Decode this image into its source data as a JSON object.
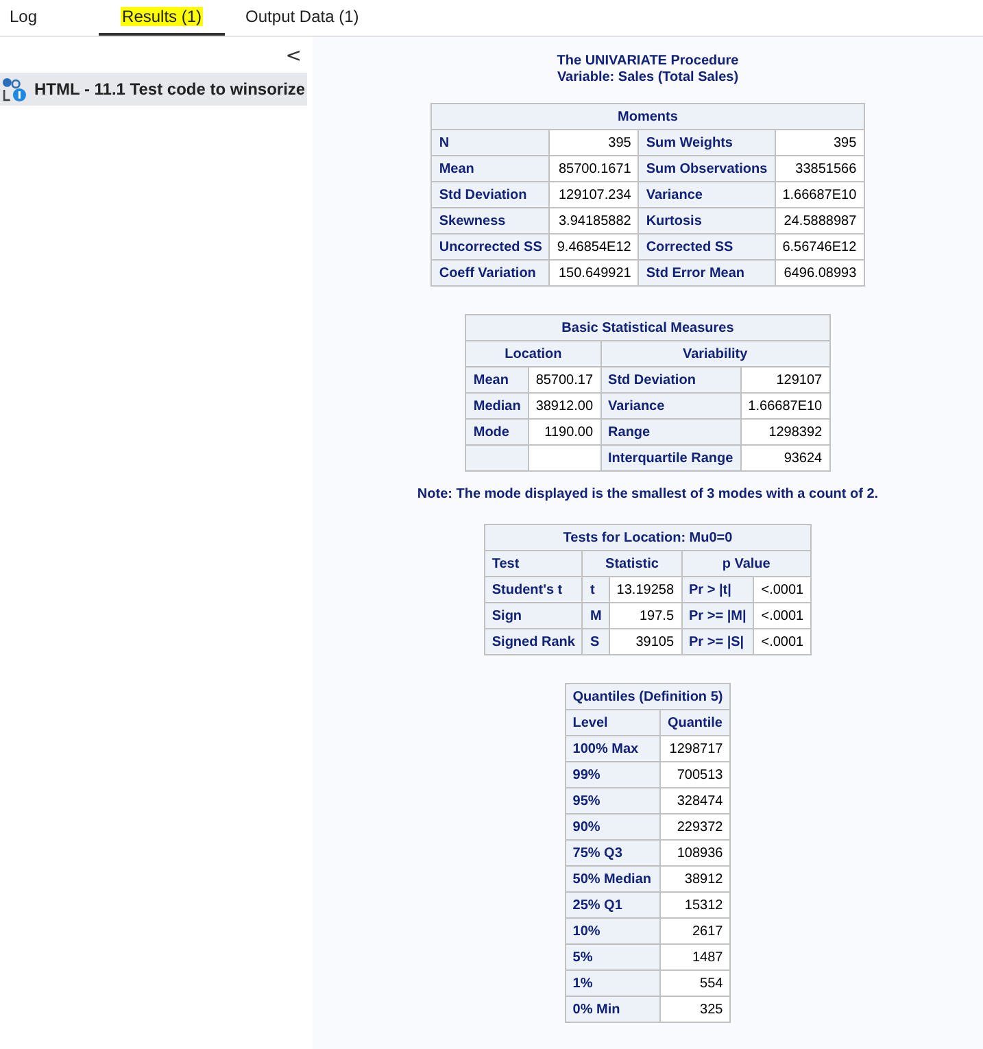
{
  "tabs": [
    {
      "label": "Log",
      "selected": false,
      "highlighted": false
    },
    {
      "label": "Results (1)",
      "selected": true,
      "highlighted": true
    },
    {
      "label": "Output Data (1)",
      "selected": false,
      "highlighted": false
    }
  ],
  "sidebar": {
    "collapse": "<",
    "items": [
      {
        "label": "HTML - 11.1 Test code to winsorize",
        "selected": true
      }
    ]
  },
  "report": {
    "titles": [
      "The UNIVARIATE Procedure",
      "Variable: Sales (Total Sales)"
    ],
    "blocks": [
      {
        "kind": "table",
        "title": "Moments",
        "rows": [
          [
            {
              "kind": "head",
              "text": "N"
            },
            {
              "kind": "data",
              "text": "395"
            },
            {
              "kind": "head",
              "text": "Sum Weights"
            },
            {
              "kind": "data",
              "text": "395"
            }
          ],
          [
            {
              "kind": "head",
              "text": "Mean"
            },
            {
              "kind": "data",
              "text": "85700.1671"
            },
            {
              "kind": "head",
              "text": "Sum Observations"
            },
            {
              "kind": "data",
              "text": "33851566"
            }
          ],
          [
            {
              "kind": "head",
              "text": "Std Deviation"
            },
            {
              "kind": "data",
              "text": "129107.234"
            },
            {
              "kind": "head",
              "text": "Variance"
            },
            {
              "kind": "data",
              "text": "1.66687E10"
            }
          ],
          [
            {
              "kind": "head",
              "text": "Skewness"
            },
            {
              "kind": "data",
              "text": "3.94185882"
            },
            {
              "kind": "head",
              "text": "Kurtosis"
            },
            {
              "kind": "data",
              "text": "24.5888987"
            }
          ],
          [
            {
              "kind": "head",
              "text": "Uncorrected SS"
            },
            {
              "kind": "data",
              "text": "9.46854E12"
            },
            {
              "kind": "head",
              "text": "Corrected SS"
            },
            {
              "kind": "data",
              "text": "6.56746E12"
            }
          ],
          [
            {
              "kind": "head",
              "text": "Coeff Variation"
            },
            {
              "kind": "data",
              "text": "150.649921"
            },
            {
              "kind": "head",
              "text": "Std Error Mean"
            },
            {
              "kind": "data",
              "text": "6496.08993"
            }
          ]
        ]
      },
      {
        "kind": "table",
        "title": "Basic Statistical Measures",
        "header": [
          {
            "kind": "pair",
            "text": "Location"
          },
          {
            "kind": "pair",
            "text": "Variability"
          }
        ],
        "rows": [
          [
            {
              "kind": "head",
              "text": "Mean"
            },
            {
              "kind": "data",
              "text": "85700.17"
            },
            {
              "kind": "head",
              "text": "Std Deviation"
            },
            {
              "kind": "data",
              "text": "129107"
            }
          ],
          [
            {
              "kind": "head",
              "text": "Median"
            },
            {
              "kind": "data",
              "text": "38912.00"
            },
            {
              "kind": "head",
              "text": "Variance"
            },
            {
              "kind": "data",
              "text": "1.66687E10"
            }
          ],
          [
            {
              "kind": "head",
              "text": "Mode"
            },
            {
              "kind": "data",
              "text": "1190.00"
            },
            {
              "kind": "head",
              "text": "Range"
            },
            {
              "kind": "data",
              "text": "1298392"
            }
          ],
          [
            {
              "kind": "head"
            },
            {
              "kind": "data"
            },
            {
              "kind": "head",
              "text": "Interquartile Range"
            },
            {
              "kind": "data",
              "text": "93624"
            }
          ]
        ]
      },
      {
        "kind": "note",
        "text": "Note: The mode displayed is the smallest of 3 modes with a count of 2."
      },
      {
        "kind": "table",
        "title": "Tests for Location: Mu0=0",
        "header": [
          {
            "kind": "left",
            "text": "Test"
          },
          {
            "kind": "pair",
            "text": "Statistic"
          },
          {
            "kind": "pair",
            "text": "p Value"
          }
        ],
        "rows": [
          [
            {
              "kind": "head",
              "text": "Student's t"
            },
            {
              "kind": "head",
              "text": "t"
            },
            {
              "kind": "data",
              "text": "13.19258"
            },
            {
              "kind": "head",
              "text": "Pr > |t|"
            },
            {
              "kind": "data",
              "text": "<.0001"
            }
          ],
          [
            {
              "kind": "head",
              "text": "Sign"
            },
            {
              "kind": "head",
              "text": "M"
            },
            {
              "kind": "data",
              "text": "197.5"
            },
            {
              "kind": "head",
              "text": "Pr >= |M|"
            },
            {
              "kind": "data",
              "text": "<.0001"
            }
          ],
          [
            {
              "kind": "head",
              "text": "Signed Rank"
            },
            {
              "kind": "head",
              "text": "S"
            },
            {
              "kind": "data",
              "text": "39105"
            },
            {
              "kind": "head",
              "text": "Pr >= |S|"
            },
            {
              "kind": "data",
              "text": "<.0001"
            }
          ]
        ]
      },
      {
        "kind": "table",
        "title": "Quantiles (Definition 5)",
        "header": [
          {
            "kind": "left",
            "text": "Level"
          },
          {
            "kind": "center",
            "text": "Quantile"
          }
        ],
        "rows": [
          [
            {
              "kind": "head",
              "text": "100% Max"
            },
            {
              "kind": "data",
              "text": "1298717"
            }
          ],
          [
            {
              "kind": "head",
              "text": "99%"
            },
            {
              "kind": "data",
              "text": "700513"
            }
          ],
          [
            {
              "kind": "head",
              "text": "95%"
            },
            {
              "kind": "data",
              "text": "328474"
            }
          ],
          [
            {
              "kind": "head",
              "text": "90%"
            },
            {
              "kind": "data",
              "text": "229372"
            }
          ],
          [
            {
              "kind": "head",
              "text": "75% Q3"
            },
            {
              "kind": "data",
              "text": "108936"
            }
          ],
          [
            {
              "kind": "head",
              "text": "50% Median"
            },
            {
              "kind": "data",
              "text": "38912"
            }
          ],
          [
            {
              "kind": "head",
              "text": "25% Q1"
            },
            {
              "kind": "data",
              "text": "15312"
            }
          ],
          [
            {
              "kind": "head",
              "text": "10%"
            },
            {
              "kind": "data",
              "text": "2617"
            }
          ],
          [
            {
              "kind": "head",
              "text": "5%"
            },
            {
              "kind": "data",
              "text": "1487"
            }
          ],
          [
            {
              "kind": "head",
              "text": "1%"
            },
            {
              "kind": "data",
              "text": "554"
            }
          ],
          [
            {
              "kind": "head",
              "text": "0% Min"
            },
            {
              "kind": "data",
              "text": "325"
            }
          ]
        ]
      }
    ]
  }
}
